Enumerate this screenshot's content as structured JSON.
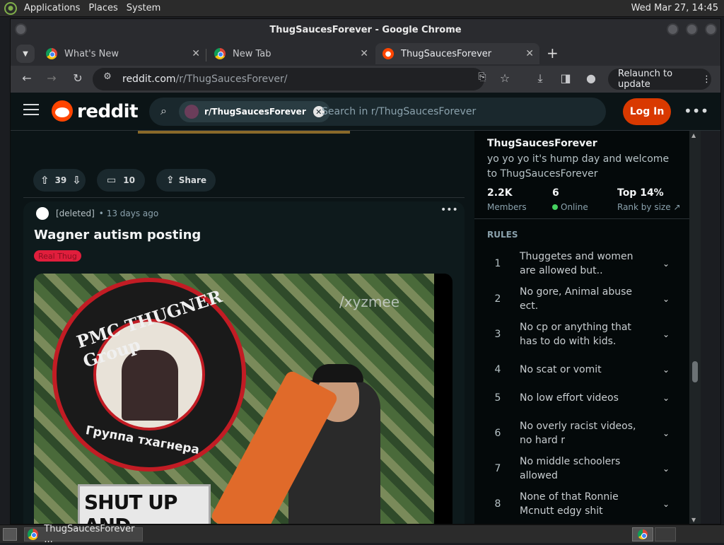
{
  "panel": {
    "menus": [
      "Applications",
      "Places",
      "System"
    ],
    "clock": "Wed Mar 27, 14:45"
  },
  "window": {
    "title": "ThugSaucesForever - Google Chrome"
  },
  "tabs": [
    {
      "label": "What's New",
      "icon": "chrome-icon",
      "active": false
    },
    {
      "label": "New Tab",
      "icon": "chrome-icon",
      "active": false
    },
    {
      "label": "ThugSaucesForever",
      "icon": "reddit-icon",
      "active": true
    }
  ],
  "toolbar": {
    "url_host": "reddit.com",
    "url_path": "/r/ThugSaucesForever/",
    "relaunch_label": "Relaunch to update"
  },
  "reddit_header": {
    "wordmark": "reddit",
    "search_chip": "r/ThugSaucesForever",
    "search_placeholder": "Search in r/ThugSaucesForever",
    "login_label": "Log In"
  },
  "prev_post_actions": {
    "votes": "39",
    "comments": "10",
    "share_label": "Share"
  },
  "post": {
    "author": "[deleted]",
    "age": "• 13 days ago",
    "title": "Wagner autism posting",
    "flair": "Real Thug",
    "media": {
      "patch_top_text": "PMC THUGNER Group",
      "patch_bottom_text": "Группа тхагнера",
      "watermark": "/xyzmee",
      "caption_text": "SHUT UP AND"
    }
  },
  "sidebar": {
    "name": "ThugSaucesForever",
    "description": "yo yo yo it's hump day and welcome to ThugSaucesForever",
    "stats": [
      {
        "value": "2.2K",
        "label": "Members"
      },
      {
        "value": "6",
        "label": "Online"
      },
      {
        "value": "Top 14%",
        "label": "Rank by size"
      }
    ],
    "rules_heading": "RULES",
    "rules": [
      {
        "n": "1",
        "text": "Thuggetes and women are allowed but.."
      },
      {
        "n": "2",
        "text": "No gore, Animal abuse ect."
      },
      {
        "n": "3",
        "text": "No cp or anything that has to do with kids."
      },
      {
        "n": "4",
        "text": "No scat or vomit"
      },
      {
        "n": "5",
        "text": "No low effort videos"
      },
      {
        "n": "6",
        "text": "No overly racist videos, no hard r"
      },
      {
        "n": "7",
        "text": "No middle schoolers allowed"
      },
      {
        "n": "8",
        "text": "None of that Ronnie Mcnutt edgy shit"
      }
    ]
  },
  "taskbar": {
    "task_label": "ThugSaucesForever ..."
  },
  "colors": {
    "reddit_orange": "#ff4500",
    "login_button": "#d93900",
    "flair": "#e01e3c",
    "online_dot": "#46d160"
  }
}
